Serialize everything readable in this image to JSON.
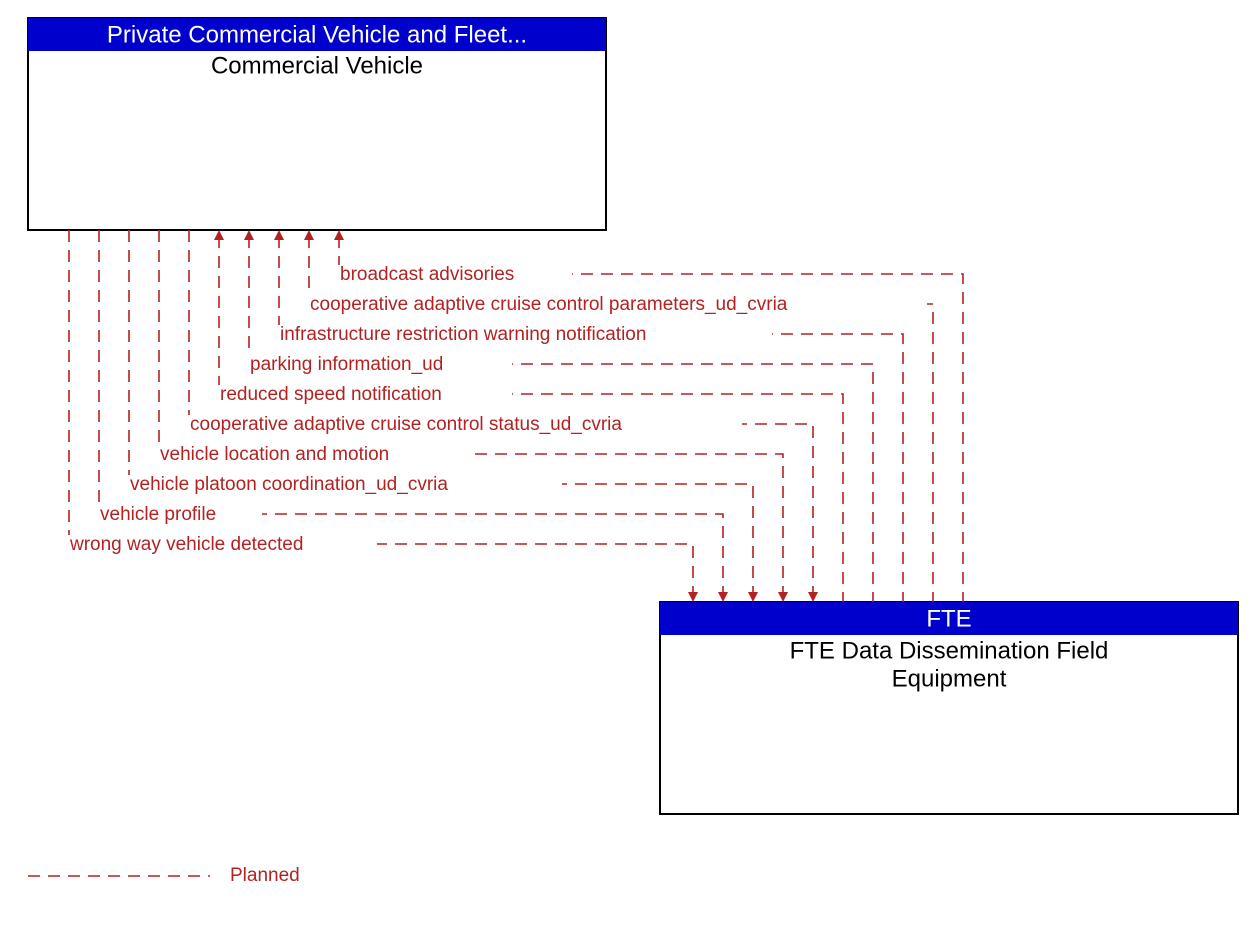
{
  "boxes": {
    "top": {
      "header": "Private Commercial Vehicle and Fleet...",
      "title": "Commercial Vehicle"
    },
    "bottom": {
      "header": "FTE",
      "title_line1": "FTE Data Dissemination Field",
      "title_line2": "Equipment"
    }
  },
  "flows": {
    "f0": "broadcast advisories",
    "f1": "cooperative adaptive cruise control parameters_ud_cvria",
    "f2": "infrastructure restriction warning notification",
    "f3": "parking information_ud",
    "f4": "reduced speed notification",
    "f5": "cooperative adaptive cruise control status_ud_cvria",
    "f6": "vehicle location and motion",
    "f7": "vehicle platoon coordination_ud_cvria",
    "f8": "vehicle profile",
    "f9": "wrong way vehicle detected"
  },
  "legend": {
    "planned": "Planned"
  },
  "colors": {
    "header_bg": "#0000cc",
    "flow": "#b22222"
  }
}
